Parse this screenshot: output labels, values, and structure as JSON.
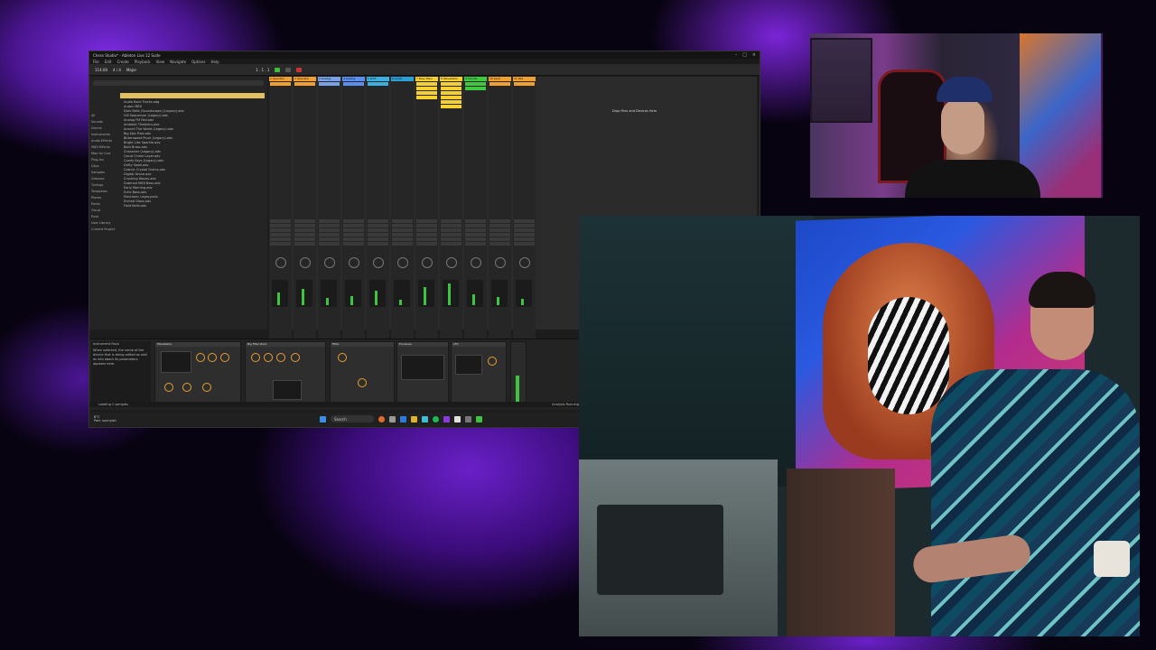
{
  "app": {
    "title": "Chess Studio* - Ableton Live 12 Suite",
    "menu": [
      "File",
      "Edit",
      "Create",
      "Playback",
      "View",
      "Navigate",
      "Options",
      "Help"
    ],
    "window_buttons": [
      "–",
      "□",
      "×"
    ]
  },
  "transport": {
    "tempo": "114.00",
    "time_sig": "4 / 4",
    "position": "1 . 1 . 1",
    "key": "Major"
  },
  "browser": {
    "places": [
      "All",
      "Sounds",
      "Drums",
      "Instruments",
      "Audio Effects",
      "MIDI Effects",
      "Max for Live",
      "Plug-Ins",
      "Clips",
      "Samples",
      "Grooves",
      "Tunings",
      "Templates",
      "Places",
      "Packs",
      "Cloud",
      "Push",
      "User Library",
      "Current Project"
    ],
    "selected_folder": "Tracks",
    "files": [
      "Audio Rack Tracks.adg",
      "Arabic MIDI",
      "Dark Bells (Soundscape) (Legacy).adv",
      "Hill Sequencer (Legacy).adv",
      "Analog FM Pad.adv",
      "Ambient Theatrics.adv",
      "Around The World (Legacy).adv",
      "Big Epic Rise.adv",
      "Bittersweet Pluck (Legacy).adv",
      "Bright Like Sparkle.adv",
      "Bold Brass.adv",
      "Character (Legacy).adv",
      "Cloud Chime Layer.adv",
      "Comfy Keys (Legacy).adv",
      "Drifty Swell.adv",
      "Cosmic Crystal Grains.adv",
      "Digital Drone.adv",
      "Crushing Waves.adv",
      "Dubmod MIDI Bass.adv",
      "Early Morning.adv",
      "Echo Bass.adv",
      "Electronic Legacy.adv",
      "Etched Glass.adv",
      "Field Bells.adv"
    ]
  },
  "tracks": [
    {
      "name": "1 Operator",
      "color": "#f0a030"
    },
    {
      "name": "2 Operator",
      "color": "#f0a030"
    },
    {
      "name": "3 Analog",
      "color": "#7aa0e8"
    },
    {
      "name": "4 Analog",
      "color": "#5a8ef0"
    },
    {
      "name": "5 Drift",
      "color": "#3bb0e0"
    },
    {
      "name": "6 Audio",
      "color": "#2aa0d8"
    },
    {
      "name": "7 Bass Main",
      "color": "#f5d030"
    },
    {
      "name": "8 Wavetable",
      "color": "#f5d030"
    },
    {
      "name": "9 Chords",
      "color": "#40c840"
    },
    {
      "name": "10 Lead",
      "color": "#f0a030"
    },
    {
      "name": "11 Pad",
      "color": "#f0a030"
    }
  ],
  "session": {
    "drop_hint": "Drop Files and Devices Here",
    "master": "Main"
  },
  "device": {
    "info_title": "Instrument Rack",
    "info_text": "When selected, the name of the device that is being edited as well as info about its parameters appears here.",
    "devices": [
      "Wavetable",
      "Big Filter Rack",
      "Filter",
      "Envelope",
      "LFO"
    ]
  },
  "statusbar": {
    "text": "Loading 1 samples",
    "right": "Analysis Running"
  },
  "taskbar": {
    "search": "Search",
    "weather_temp": "8°C",
    "weather_desc": "Part. sunnyish"
  }
}
